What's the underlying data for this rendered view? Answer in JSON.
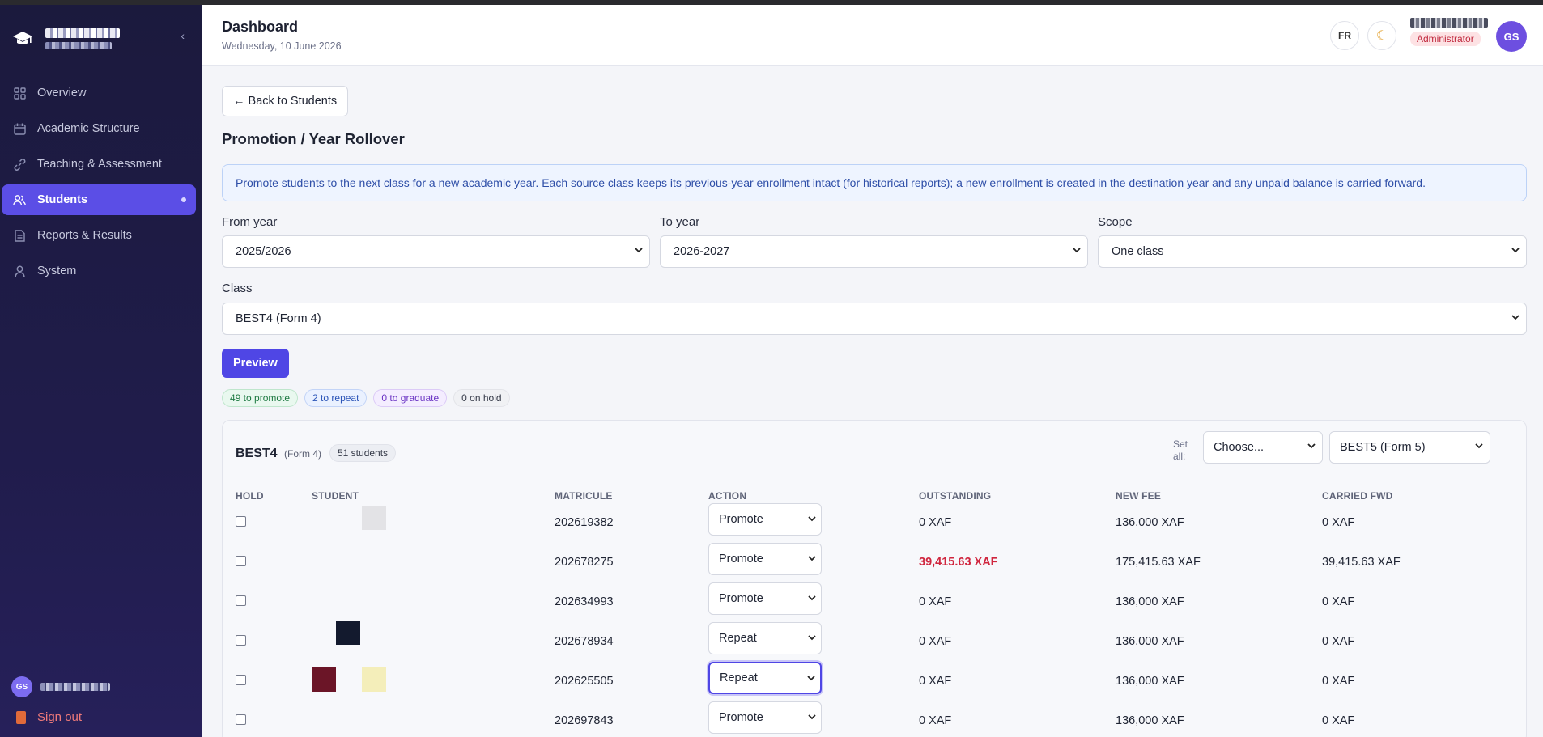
{
  "sidebar": {
    "items": [
      {
        "label": "Overview",
        "icon": "grid-icon"
      },
      {
        "label": "Academic Structure",
        "icon": "calendar-icon"
      },
      {
        "label": "Teaching & Assessment",
        "icon": "link-icon"
      },
      {
        "label": "Students",
        "icon": "users-icon",
        "active": true
      },
      {
        "label": "Reports & Results",
        "icon": "document-icon"
      },
      {
        "label": "System",
        "icon": "user-icon"
      }
    ],
    "collapse_glyph": "‹",
    "user_initials": "GS",
    "signout_label": "Sign out"
  },
  "header": {
    "title": "Dashboard",
    "date": "Wednesday, 10 June 2026",
    "lang_label": "FR",
    "theme_glyph": "☾",
    "role": "Administrator",
    "avatar_initials": "GS"
  },
  "main": {
    "back_label": "← Back to Students",
    "section_title": "Promotion / Year Rollover",
    "info_text": "Promote students to the next class for a new academic year. Each source class keeps its previous-year enrollment intact (for historical reports); a new enrollment is created in the destination year and any unpaid balance is carried forward.",
    "from_year": {
      "label": "From year",
      "value": "2025/2026"
    },
    "to_year": {
      "label": "To year",
      "value": "2026-2027"
    },
    "scope": {
      "label": "Scope",
      "value": "One class"
    },
    "class": {
      "label": "Class",
      "value": "BEST4 (Form 4)"
    },
    "preview_label": "Preview",
    "summary": {
      "promote": "49 to promote",
      "repeat": "2 to repeat",
      "graduate": "0 to graduate",
      "hold": "0 on hold"
    }
  },
  "card": {
    "class_code": "BEST4",
    "class_form": "(Form 4)",
    "student_count": "51 students",
    "set_all_label": "Set all:",
    "set_all_value": "Choose...",
    "destination_value": "BEST5 (Form 5)",
    "columns": {
      "hold": "HOLD",
      "student": "STUDENT",
      "matricule": "MATRICULE",
      "action": "ACTION",
      "outstanding": "OUTSTANDING",
      "new_fee": "NEW FEE",
      "carried": "CARRIED FWD"
    },
    "rows": [
      {
        "matricule": "202619382",
        "action": "Promote",
        "outstanding": "0 XAF",
        "new_fee": "136,000 XAF",
        "carried": "0 XAF"
      },
      {
        "matricule": "202678275",
        "action": "Promote",
        "outstanding": "39,415.63 XAF",
        "new_fee": "175,415.63 XAF",
        "carried": "39,415.63 XAF"
      },
      {
        "matricule": "202634993",
        "action": "Promote",
        "outstanding": "0 XAF",
        "new_fee": "136,000 XAF",
        "carried": "0 XAF"
      },
      {
        "matricule": "202678934",
        "action": "Repeat",
        "outstanding": "0 XAF",
        "new_fee": "136,000 XAF",
        "carried": "0 XAF"
      },
      {
        "matricule": "202625505",
        "action": "Repeat",
        "outstanding": "0 XAF",
        "new_fee": "136,000 XAF",
        "carried": "0 XAF"
      },
      {
        "matricule": "202697843",
        "action": "Promote",
        "outstanding": "0 XAF",
        "new_fee": "136,000 XAF",
        "carried": "0 XAF"
      }
    ]
  },
  "colors": {
    "accent": "#4f46e5",
    "sidebar_bg": "#1b1a3d",
    "outstanding_red": "#d0263e"
  }
}
